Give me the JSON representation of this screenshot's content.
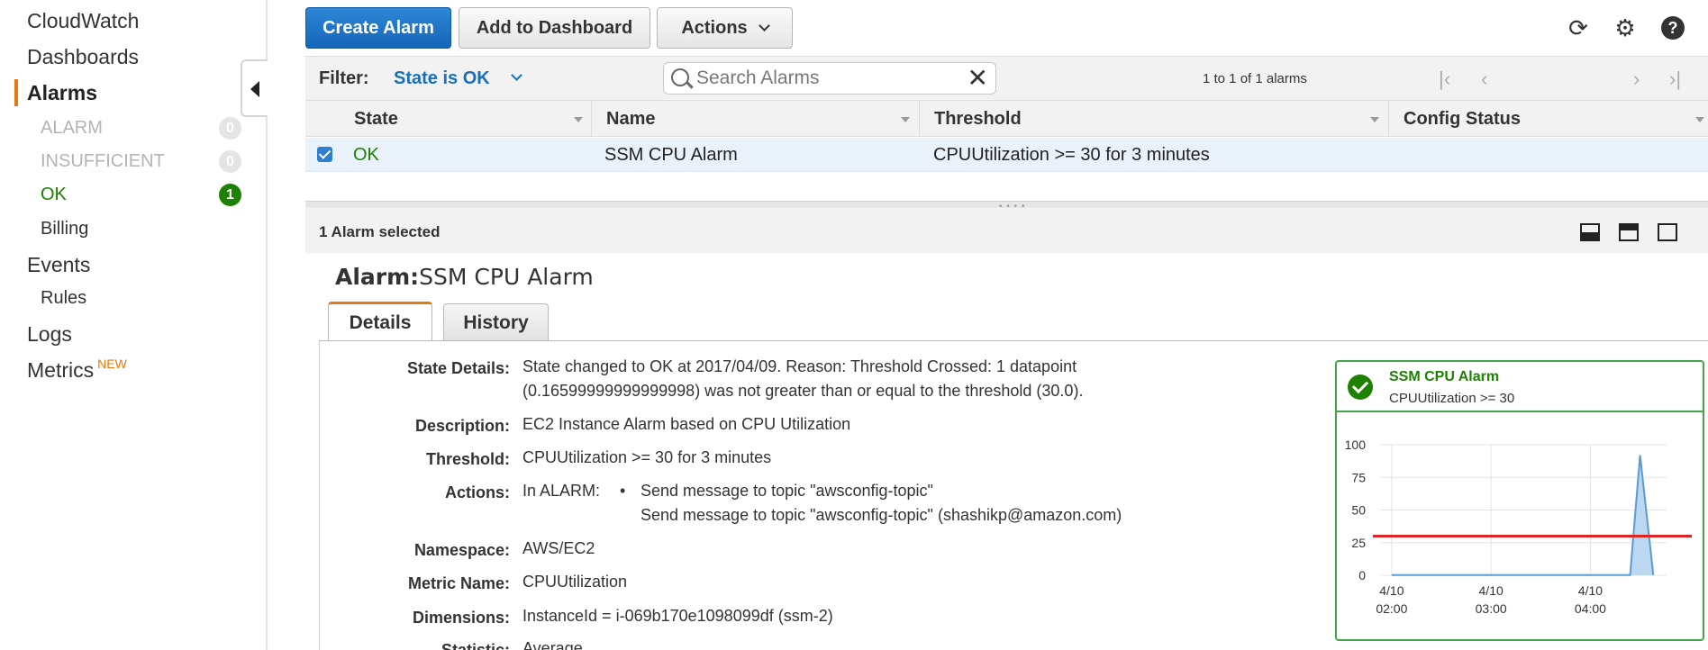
{
  "sidebar": {
    "cloudwatch": "CloudWatch",
    "dashboards": "Dashboards",
    "alarms": "Alarms",
    "alarm_states": [
      {
        "label": "ALARM",
        "count": "0"
      },
      {
        "label": "INSUFFICIENT",
        "count": "0"
      },
      {
        "label": "OK",
        "count": "1"
      }
    ],
    "billing": "Billing",
    "events": "Events",
    "rules": "Rules",
    "logs": "Logs",
    "metrics": "Metrics",
    "metrics_badge": "NEW"
  },
  "toolbar": {
    "create_alarm": "Create Alarm",
    "add_to_dashboard": "Add to Dashboard",
    "actions": "Actions"
  },
  "filter": {
    "label": "Filter:",
    "value": "State is OK",
    "search_placeholder": "Search Alarms",
    "pager_text": "1 to 1 of 1 alarms"
  },
  "table": {
    "columns": [
      "State",
      "Name",
      "Threshold",
      "Config Status"
    ],
    "rows": [
      {
        "state": "OK",
        "name": "SSM CPU Alarm",
        "threshold": "CPUUtilization >= 30 for 3 minutes",
        "config_status": ""
      }
    ]
  },
  "selection": {
    "text": "1 Alarm selected"
  },
  "alarm": {
    "title_prefix": "Alarm:",
    "title_name": "SSM CPU Alarm",
    "tabs": [
      "Details",
      "History"
    ],
    "details": {
      "state_details_label": "State Details:",
      "state_details_line1": "State changed to OK at 2017/04/09. Reason: Threshold Crossed: 1 datapoint",
      "state_details_line2": "(0.16599999999999998) was not greater than or equal to the threshold (30.0).",
      "description_label": "Description:",
      "description": "EC2 Instance Alarm based on CPU Utilization",
      "threshold_label": "Threshold:",
      "threshold": "CPUUtilization >= 30 for 3 minutes",
      "actions_label": "Actions:",
      "actions_state": "In ALARM:",
      "action_1": "Send message to topic \"awsconfig-topic\"",
      "action_2": "Send message to topic \"awsconfig-topic\" (shashikp@amazon.com)",
      "namespace_label": "Namespace:",
      "namespace": "AWS/EC2",
      "metric_name_label": "Metric Name:",
      "metric_name": "CPUUtilization",
      "dimensions_label": "Dimensions:",
      "dimensions": "InstanceId = i-069b170e1098099df (ssm-2)",
      "statistic_label": "Statistic:",
      "statistic": "Average"
    }
  },
  "mini_chart": {
    "title": "SSM CPU Alarm",
    "subtitle": "CPUUtilization >= 30"
  },
  "chart_data": {
    "type": "area",
    "title": "SSM CPU Alarm",
    "subtitle": "CPUUtilization >= 30",
    "y_ticks": [
      0,
      25,
      50,
      75,
      100
    ],
    "ylim": [
      0,
      100
    ],
    "x_tick_labels": [
      [
        "4/10",
        "02:00"
      ],
      [
        "4/10",
        "03:00"
      ],
      [
        "4/10",
        "04:00"
      ]
    ],
    "x_ticks_minutes": [
      120,
      180,
      240
    ],
    "xlim_minutes": [
      113,
      286
    ],
    "threshold": 30,
    "colors": {
      "series": "#5b9bd5",
      "fill": "#bcd7f0",
      "threshold": "#e02424",
      "grid": "#e4e4e4"
    },
    "series": [
      {
        "x_minutes": [
          120,
          140,
          160,
          180,
          200,
          220,
          240,
          255,
          264,
          270,
          278
        ],
        "values": [
          0.2,
          0.2,
          0.2,
          0.2,
          0.2,
          0.2,
          0.2,
          0.2,
          0.2,
          92,
          0.2
        ]
      }
    ]
  },
  "colors": {
    "primary": "#1566b8",
    "ok": "#1d8102",
    "active_marker": "#e47911",
    "link": "#1a6fb8"
  }
}
